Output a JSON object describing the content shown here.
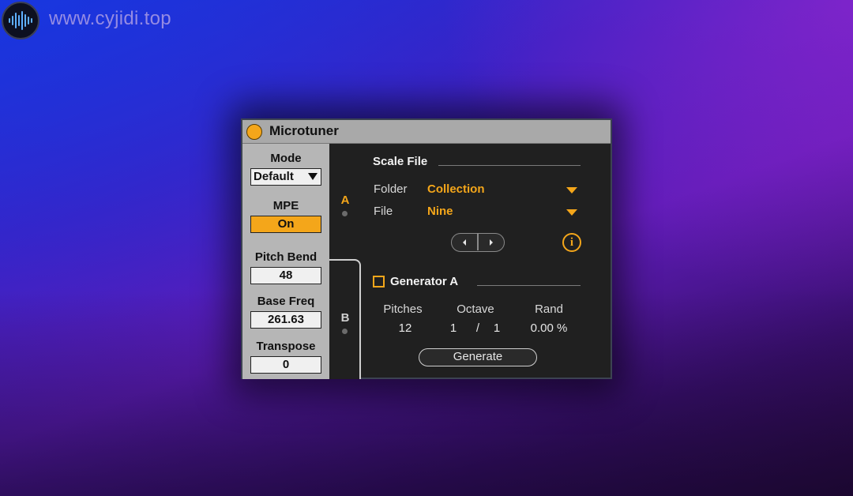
{
  "watermark": {
    "site": "www.cyjidi.top",
    "logo_icon": "waveform-icon"
  },
  "device": {
    "title": "Microtuner",
    "accent_color": "#f4a61a",
    "left_panel": {
      "mode_label": "Mode",
      "mode_value": "Default",
      "mpe_label": "MPE",
      "mpe_value": "On",
      "pitch_bend_label": "Pitch Bend",
      "pitch_bend_value": "48",
      "base_freq_label": "Base Freq",
      "base_freq_value": "261.63",
      "transpose_label": "Transpose",
      "transpose_value": "0"
    },
    "tabs": [
      {
        "label": "A",
        "active": true
      },
      {
        "label": "B",
        "active": false
      }
    ],
    "scale_file": {
      "heading": "Scale File",
      "folder_label": "Folder",
      "folder_value": "Collection",
      "file_label": "File",
      "file_value": "Nine",
      "info_icon": "info-icon",
      "prev_icon": "prev-arrow-icon",
      "next_icon": "next-arrow-icon"
    },
    "generator": {
      "heading": "Generator A",
      "checked": false,
      "pitches_label": "Pitches",
      "pitches_value": "12",
      "octave_label": "Octave",
      "octave_num": "1",
      "octave_sep": "/",
      "octave_den": "1",
      "rand_label": "Rand",
      "rand_value": "0.00 %",
      "generate_label": "Generate"
    }
  }
}
